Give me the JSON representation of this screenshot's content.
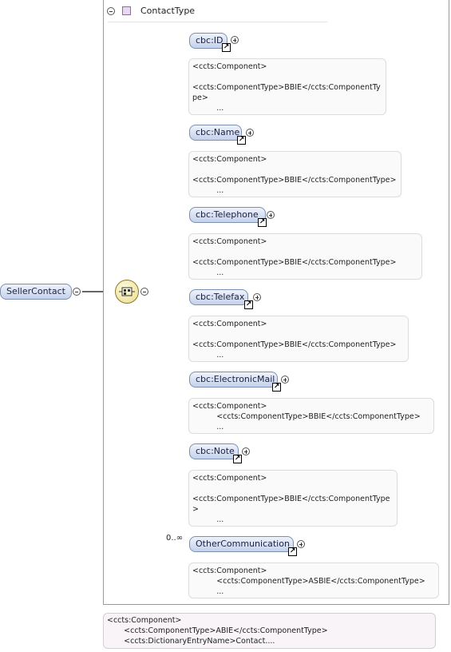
{
  "root": {
    "label": "SellerContact"
  },
  "type": {
    "title": "ContactType"
  },
  "elements": [
    {
      "label": "cbc:ID",
      "annotation": "<ccts:Component>\n\n<ccts:ComponentType>BBIE</ccts:ComponentTy\npe>\n          ..."
    },
    {
      "label": "cbc:Name",
      "annotation": "<ccts:Component>\n\n<ccts:ComponentType>BBIE</ccts:ComponentType>\n          ..."
    },
    {
      "label": "cbc:Telephone",
      "annotation": "<ccts:Component>\n\n<ccts:ComponentType>BBIE</ccts:ComponentType>\n          ..."
    },
    {
      "label": "cbc:Telefax",
      "annotation": "<ccts:Component>\n\n<ccts:ComponentType>BBIE</ccts:ComponentType>\n          ..."
    },
    {
      "label": "cbc:ElectronicMail",
      "annotation": "<ccts:Component>\n          <ccts:ComponentType>BBIE</ccts:ComponentType>\n          ..."
    },
    {
      "label": "cbc:Note",
      "annotation": "<ccts:Component>\n\n<ccts:ComponentType>BBIE</ccts:ComponentType\n>\n          ..."
    },
    {
      "label": "OtherCommunication",
      "occurrence": "0..∞",
      "annotation": "<ccts:Component>\n          <ccts:ComponentType>ASBIE</ccts:ComponentType>\n          ..."
    }
  ],
  "type_annotation": "<ccts:Component>\n       <ccts:ComponentType>ABIE</ccts:ComponentType>\n       <ccts:DictionaryEntryName>Contact...."
}
